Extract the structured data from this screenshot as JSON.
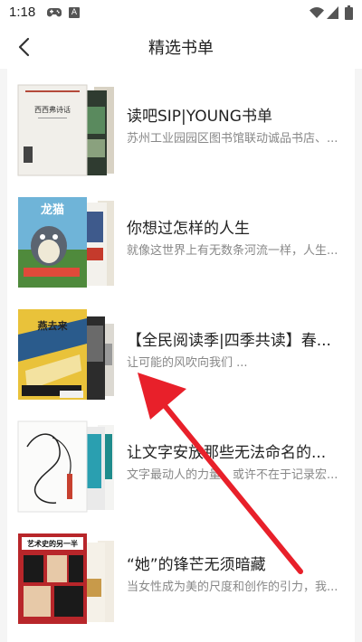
{
  "status_bar": {
    "time": "1:18",
    "badge_letter": "A",
    "icons": [
      "gamepad-icon",
      "a-badge-icon",
      "wifi-icon",
      "signal-icon",
      "battery-icon"
    ]
  },
  "header": {
    "title": "精选书单",
    "back_icon": "chevron-left-icon"
  },
  "booklists": [
    {
      "title": "读吧SIP|YOUNG书单",
      "description": "苏州工业园园区图书馆联动诚品书店、...",
      "cover_text": "西西弗诗话"
    },
    {
      "title": "你想过怎样的人生",
      "description": "就像这世界上有无数条河流一样，人生...",
      "cover_text": "龙猫"
    },
    {
      "title": "【全民阅读季|四季共读】春...",
      "description": "让可能的风吹向我们 ...",
      "cover_text": "燕去来"
    },
    {
      "title": "让文字安放那些无法命名的...",
      "description": "文字最动人的力量，或许不在于记录宏...",
      "cover_text": ""
    },
    {
      "title": "“她”的锋芒无须暗藏",
      "description": "当女性成为美的尺度和创作的引力，我...",
      "cover_text": "艺术史的另一半"
    }
  ],
  "colors": {
    "annotation_arrow": "#e8202a",
    "title_text": "#222222",
    "desc_text": "#888888",
    "page_background": "#f5f5f5"
  }
}
